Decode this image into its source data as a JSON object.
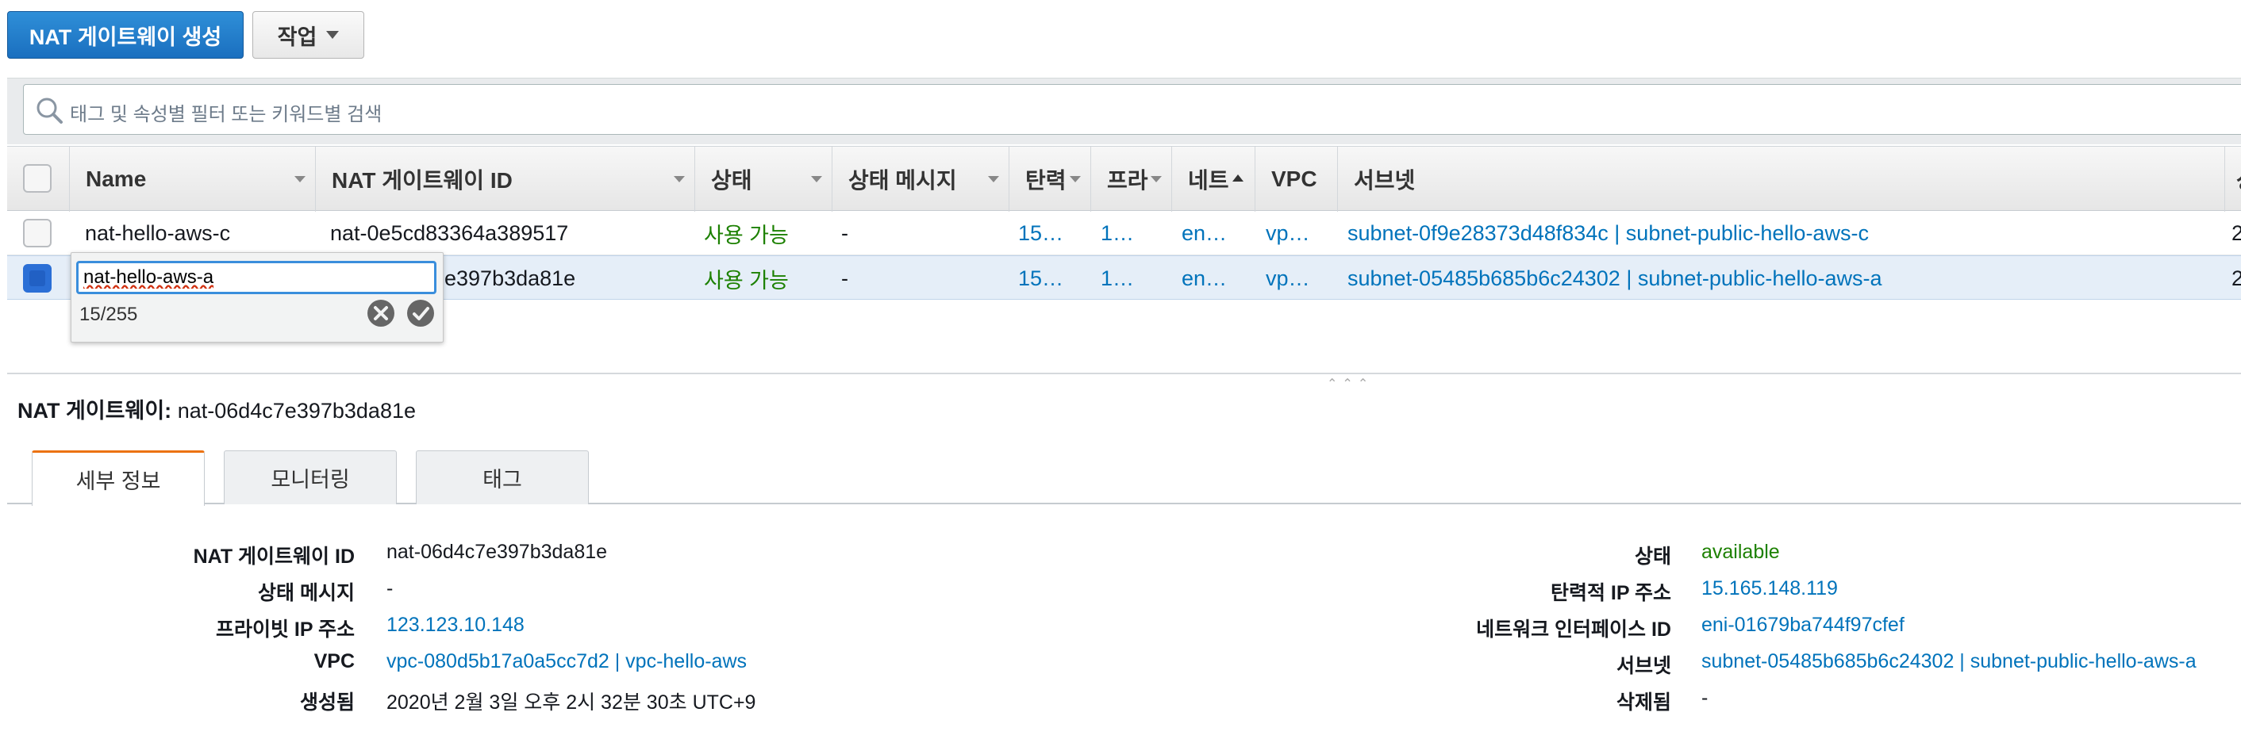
{
  "toolbar": {
    "create_label": "NAT 게이트웨이 생성",
    "actions_label": "작업",
    "search_placeholder": "태그 및 속성별 필터 또는 키워드별 검색"
  },
  "table": {
    "columns": [
      "Name",
      "NAT 게이트웨이 ID",
      "상태",
      "상태 메시지",
      "탄력",
      "프라",
      "네트",
      "VPC",
      "서브넷",
      "상"
    ],
    "rows": [
      {
        "name": "nat-hello-aws-c",
        "id": "nat-0e5cd83364a389517",
        "status": "사용 가능",
        "message": "-",
        "eip": "15…",
        "private_ip": "1…",
        "eni": "en…",
        "vpc": "vp…",
        "subnet": "subnet-0f9e28373d48f834c | subnet-public-hello-aws-c",
        "extra": "2"
      },
      {
        "name": "nat-hello-aws-a",
        "id_partial": "e397b3da81e",
        "status": "사용 가능",
        "message": "-",
        "eip": "15…",
        "private_ip": "1…",
        "eni": "en…",
        "vpc": "vp…",
        "subnet": "subnet-05485b685b6c24302 | subnet-public-hello-aws-a",
        "extra": "2"
      }
    ]
  },
  "inline_edit": {
    "value": "nat-hello-aws-a",
    "counter": "15/255"
  },
  "details": {
    "title_label": "NAT 게이트웨이:",
    "title_value": "nat-06d4c7e397b3da81e",
    "tabs": [
      "세부 정보",
      "모니터링",
      "태그"
    ],
    "left": [
      {
        "label": "NAT 게이트웨이 ID",
        "value": "nat-06d4c7e397b3da81e"
      },
      {
        "label": "상태 메시지",
        "value": "-"
      },
      {
        "label": "프라이빗 IP 주소",
        "value": "123.123.10.148"
      },
      {
        "label": "VPC",
        "value": "vpc-080d5b17a0a5cc7d2 | vpc-hello-aws"
      },
      {
        "label": "생성됨",
        "value": "2020년 2월 3일 오후 2시 32분 30초 UTC+9"
      }
    ],
    "right": [
      {
        "label": "상태",
        "value": "available"
      },
      {
        "label": "탄력적 IP 주소",
        "value": "15.165.148.119"
      },
      {
        "label": "네트워크 인터페이스 ID",
        "value": "eni-01679ba744f97cfef"
      },
      {
        "label": "서브넷",
        "value": "subnet-05485b685b6c24302 | subnet-public-hello-aws-a"
      },
      {
        "label": "삭제됨",
        "value": "-"
      }
    ]
  },
  "colors": {
    "primary": "#1a6fbf",
    "link": "#0073bb",
    "available": "#1d8102",
    "tab_accent": "#ec7211"
  }
}
